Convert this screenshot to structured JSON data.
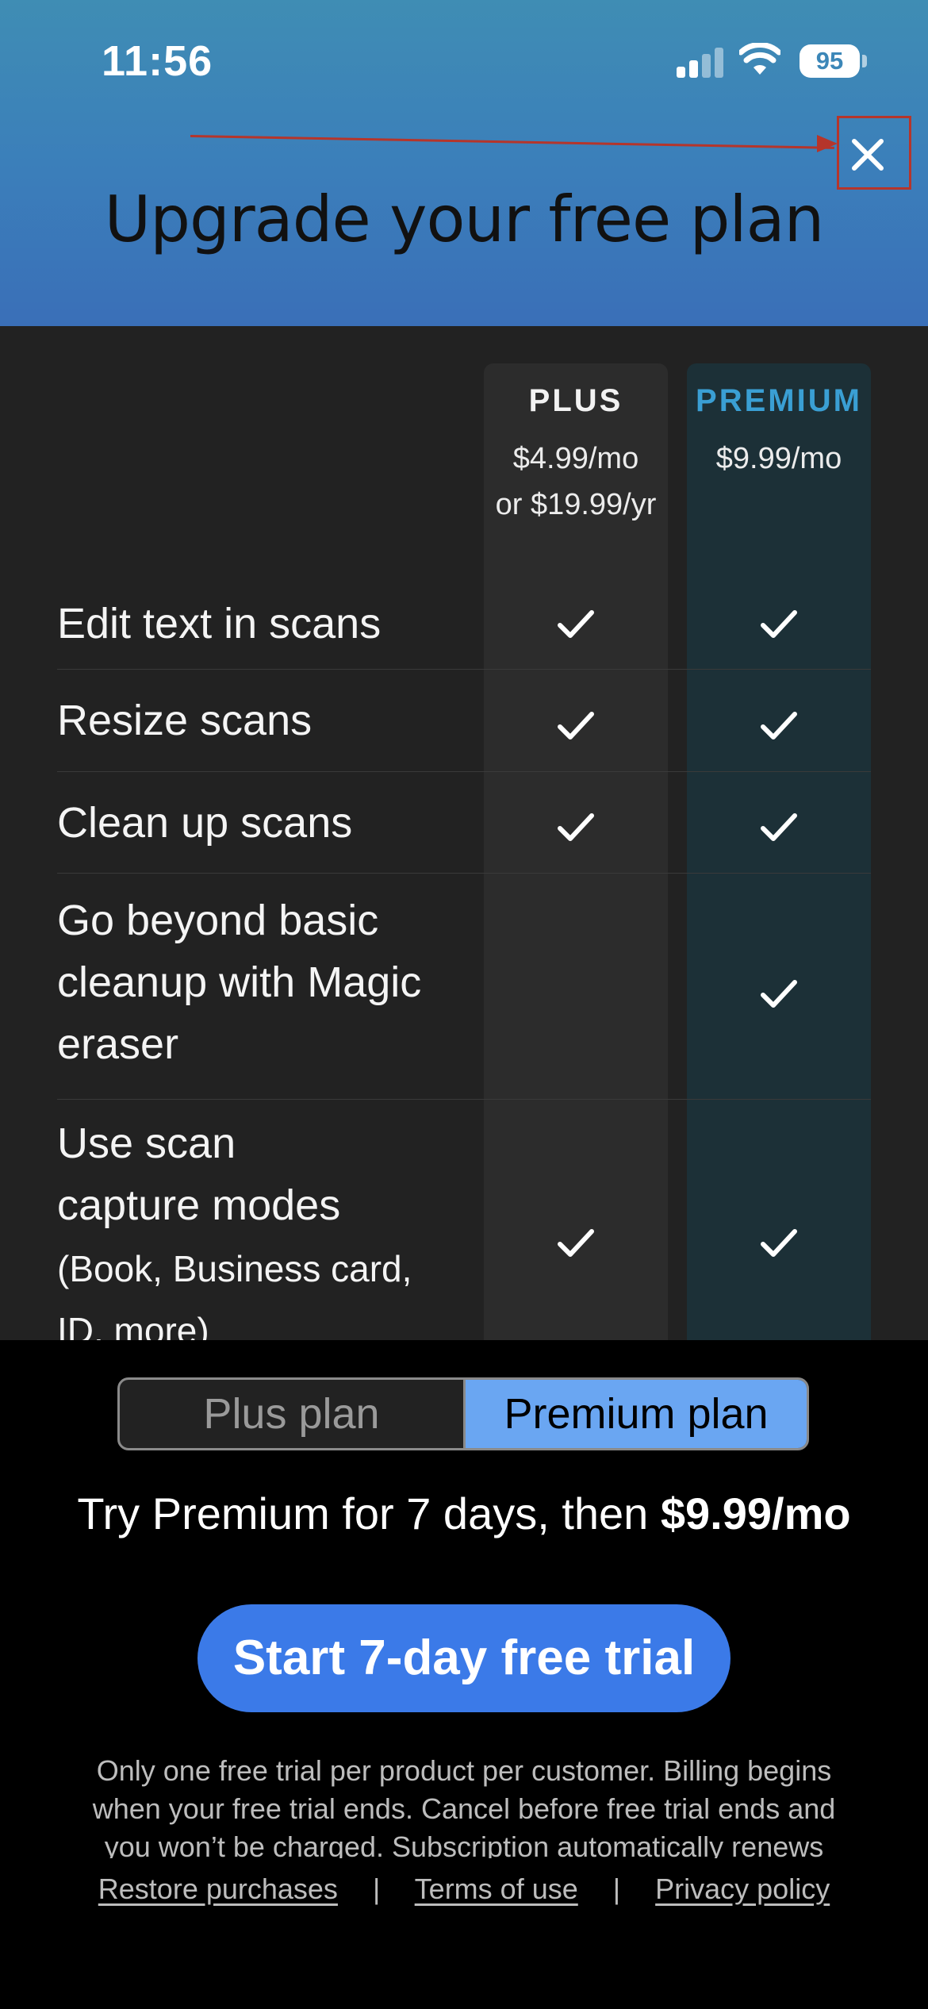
{
  "status_bar": {
    "time": "11:56",
    "battery": "95"
  },
  "header": {
    "title": "Upgrade your free plan",
    "close_icon": "close-icon"
  },
  "plans": {
    "plus": {
      "name": "PLUS",
      "price_monthly": "$4.99/mo",
      "price_yearly": "or $19.99/yr"
    },
    "premium": {
      "name": "PREMIUM",
      "price_monthly": "$9.99/mo"
    }
  },
  "features": [
    {
      "label": "Edit text in scans",
      "plus": true,
      "premium": true
    },
    {
      "label": "Resize scans",
      "plus": true,
      "premium": true
    },
    {
      "label": "Clean up scans",
      "plus": true,
      "premium": true
    },
    {
      "label": "Go beyond basic cleanup with Magic eraser",
      "plus": false,
      "premium": true
    },
    {
      "label": "Use scan capture modes",
      "sublabel": "(Book, Business card, ID, more)",
      "plus": true,
      "premium": true
    }
  ],
  "plan_toggle": {
    "plus_label": "Plus plan",
    "premium_label": "Premium plan",
    "selected": "premium"
  },
  "trial": {
    "text_prefix": "Try Premium for 7 days, then ",
    "price": "$9.99/mo"
  },
  "cta_label": "Start 7-day free trial",
  "legal_text": "Only one free trial per product per customer. Billing begins when your free trial ends. Cancel before free trial ends and you won’t be charged. Subscription automatically renews",
  "links": {
    "restore": "Restore purchases",
    "terms": "Terms of use",
    "privacy": "Privacy policy",
    "separator": "|"
  },
  "colors": {
    "accent": "#3b7ae8",
    "premium_label": "#3a9fd4",
    "toggle_selected": "#6aa6f2",
    "annotation": "#b5352b"
  }
}
